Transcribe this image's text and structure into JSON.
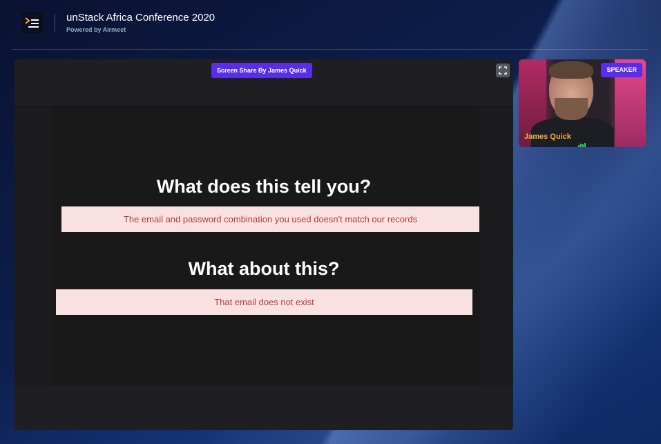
{
  "header": {
    "title": "unStack Africa Conference 2020",
    "subtitle": "Powered by Airmeet"
  },
  "stage": {
    "share_badge": "Screen Share By James Quick",
    "slide": {
      "heading_1": "What does this tell you?",
      "message_1": "The email and password combination you used doesn't match our records",
      "heading_2": "What about this?",
      "message_2": "That email does not exist"
    }
  },
  "speaker": {
    "badge": "SPEAKER",
    "name": "James Quick"
  },
  "colors": {
    "accent": "#5a2ee8",
    "error_text": "#b23b3b",
    "error_bg": "#fae1e1",
    "speaker_name": "#f2b13b"
  },
  "icons": [
    "airmeet-logo-icon",
    "fullscreen-icon",
    "mic-level-icon"
  ]
}
